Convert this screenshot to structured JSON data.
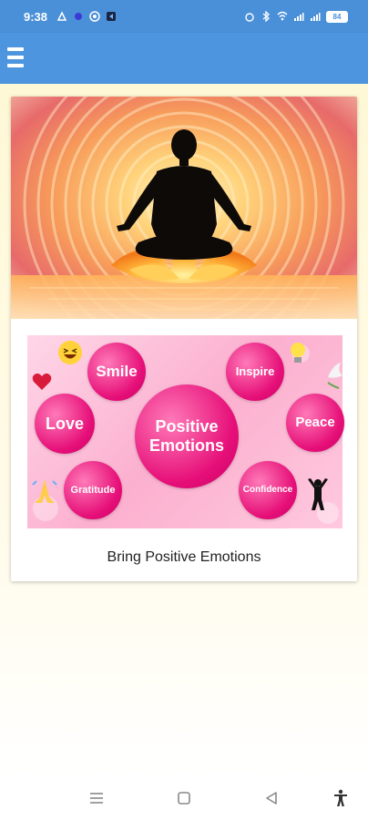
{
  "status_bar": {
    "time": "9:38",
    "battery": "84"
  },
  "app_bar": {
    "menu_icon": "hamburger-menu-icon"
  },
  "card": {
    "title": "Bring Positive Emotions",
    "emotions": {
      "center": "Positive\nEmotions",
      "smile": "Smile",
      "inspire": "Inspire",
      "love": "Love",
      "peace": "Peace",
      "gratitude": "Gratitude",
      "confidence": "Confidence"
    }
  },
  "nav_bar": {
    "icons": [
      "recents-menu-icon",
      "home-square-icon",
      "back-triangle-icon",
      "accessibility-person-icon"
    ]
  },
  "colors": {
    "app_bar": "#4e95df",
    "status_bar": "#4a90d9",
    "background": "#fffbe6",
    "circle_pink": "#e60f78"
  }
}
